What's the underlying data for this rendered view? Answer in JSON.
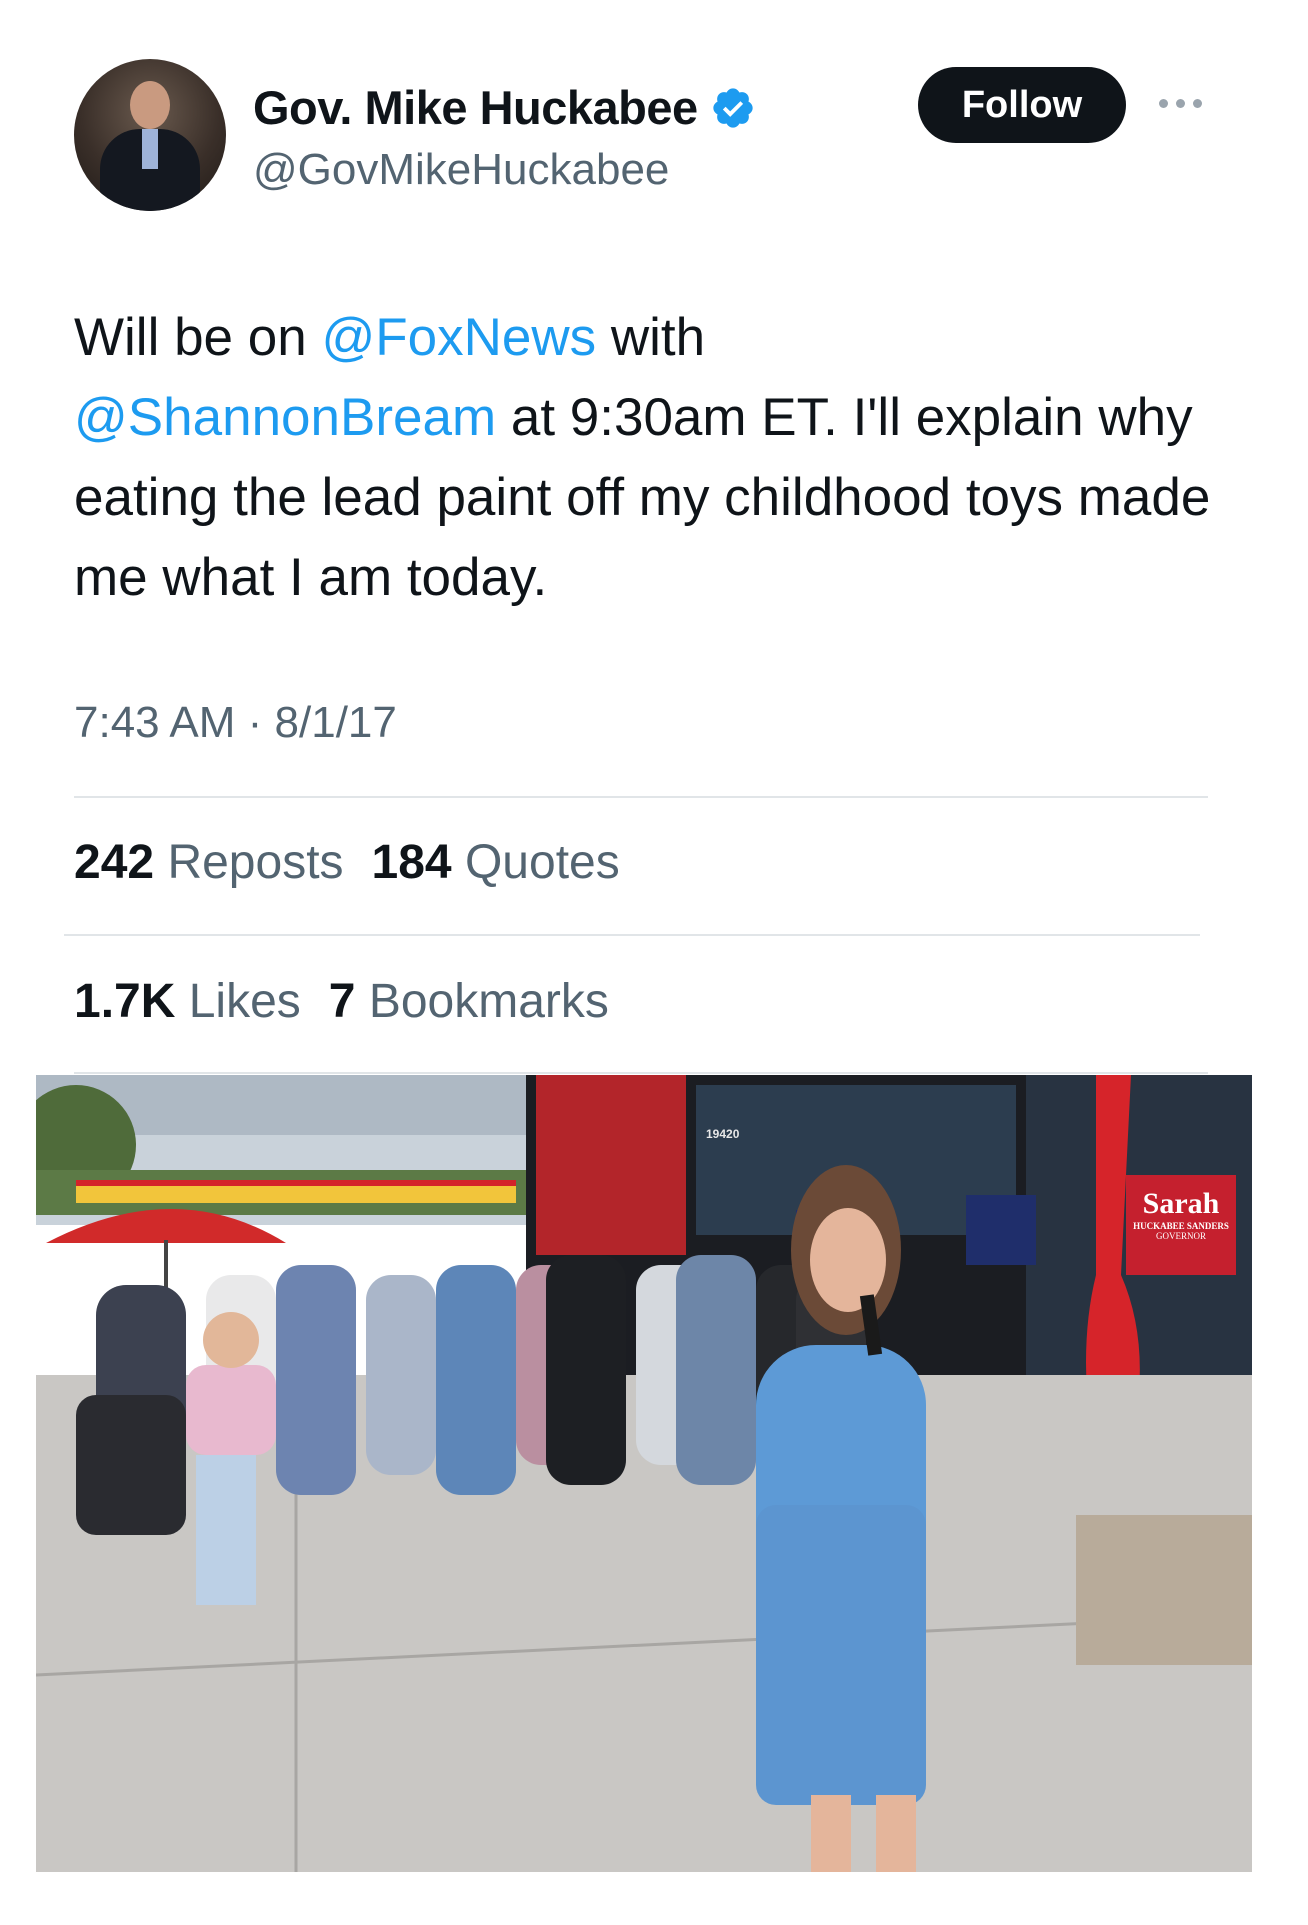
{
  "author": {
    "display_name": "Gov. Mike Huckabee",
    "handle": "@GovMikeHuckabee",
    "verified_icon": "verified-badge-icon"
  },
  "actions": {
    "follow_label": "Follow",
    "more_icon": "more-options-icon"
  },
  "tweet": {
    "text_1": "Will be on ",
    "mention_1": "@FoxNews",
    "text_2": " with",
    "mention_2": "@ShannonBream",
    "text_3": " at 9:30am ET.  I'll explain why eating the lead paint off my childhood toys made me what I am today.",
    "timestamp": "7:43 AM · 8/1/17"
  },
  "stats": {
    "reposts_count": "242",
    "reposts_label": "Reposts",
    "quotes_count": "184",
    "quotes_label": "Quotes",
    "likes_count": "1.7K",
    "likes_label": "Likes",
    "bookmarks_count": "7",
    "bookmarks_label": "Bookmarks"
  },
  "media": {
    "sign_text": "Sarah",
    "sign_subtext": "HUCKABEE SANDERS",
    "sign_role": "GOVERNOR",
    "storefront_number": "19420"
  },
  "colors": {
    "link": "#1d9bf0",
    "verified": "#1d9bf0",
    "secondary_text": "#536471",
    "button_bg": "#0f1419"
  }
}
